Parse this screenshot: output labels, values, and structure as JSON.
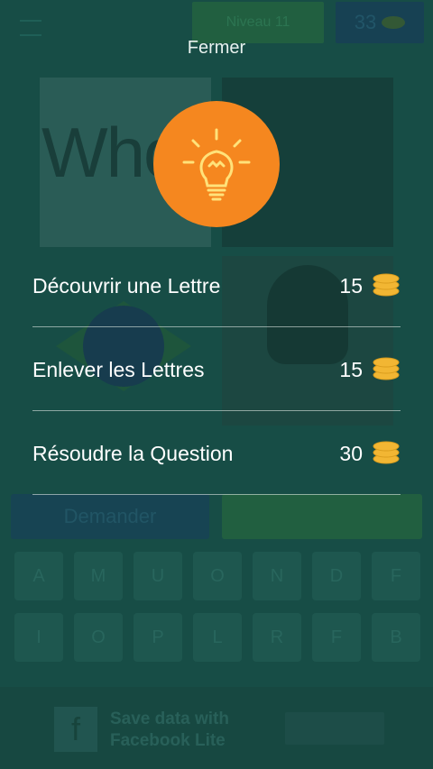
{
  "background": {
    "level_label": "Niveau 11",
    "coin_count": "33",
    "tile_text": "Who",
    "ask_button": "Demander",
    "keyboard_row1": [
      "A",
      "M",
      "U",
      "O",
      "N",
      "D",
      "F"
    ],
    "keyboard_row2": [
      "I",
      "O",
      "P",
      "L",
      "R",
      "F",
      "B"
    ],
    "ad_text": "Save data with Facebook Lite"
  },
  "dialog": {
    "close_label": "Fermer",
    "options": [
      {
        "label": "Découvrir une Lettre",
        "cost": "15"
      },
      {
        "label": "Enlever les Lettres",
        "cost": "15"
      },
      {
        "label": "Résoudre la Question",
        "cost": "30"
      }
    ]
  },
  "colors": {
    "accent": "#f5871f",
    "coin": "#f2b633",
    "background": "#1f5e57"
  },
  "icons": {
    "hint": "lightbulb-icon",
    "coin": "coin-stack-icon"
  }
}
